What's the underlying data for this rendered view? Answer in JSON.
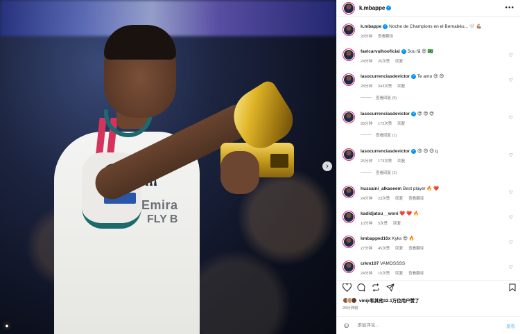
{
  "post": {
    "username": "k.mbappe",
    "more_icon": "more-horizontal-icon",
    "caption_user": "k.mbappe",
    "caption_text": "Noche de Champions en el Bernabéu... 🤍 💪🏽",
    "caption_time": "28分钟",
    "caption_translate": "查看翻译"
  },
  "photo": {
    "shirt_text_1": "Emira",
    "shirt_text_2": "FLY B",
    "carousel_next_icon": "chevron-right-icon",
    "tag_icon": "person-tag-icon"
  },
  "comments": [
    {
      "user": "faelcarvalhooficial",
      "verified": true,
      "text": "Sou fã 😍 🇧🇷",
      "time": "24分钟",
      "likes": "26次赞",
      "reply": "回复",
      "translate": "",
      "replies": ""
    },
    {
      "user": "lasocurrenciasdevictor",
      "verified": true,
      "text": "Te amo 😍 😍",
      "time": "28分钟",
      "likes": "343次赞",
      "reply": "回复",
      "translate": "",
      "replies": "查看回复 (5)"
    },
    {
      "user": "lasocurrenciasdevictor",
      "verified": true,
      "text": "😍 😍 😍",
      "time": "28分钟",
      "likes": "172次赞",
      "reply": "回复",
      "translate": "",
      "replies": "查看回复 (1)"
    },
    {
      "user": "lasocurrenciasdevictor",
      "verified": true,
      "text": "😍 😍 😍 q",
      "time": "26分钟",
      "likes": "173次赞",
      "reply": "回复",
      "translate": "",
      "replies": "查看回复 (1)"
    },
    {
      "user": "hussaini_alkaseem",
      "verified": false,
      "text": "Best player 🔥 ❤️",
      "time": "24分钟",
      "likes": "23次赞",
      "reply": "回复",
      "translate": "查看翻译",
      "replies": ""
    },
    {
      "user": "kadidjatou__woni",
      "verified": false,
      "text": "❤️ ❤️ 🔥",
      "time": "10分钟",
      "likes": "5次赞",
      "reply": "回复",
      "translate": "",
      "replies": ""
    },
    {
      "user": "kmbapped10x",
      "verified": false,
      "text": "Kyks 😍 🔥",
      "time": "27分钟",
      "likes": "45次赞",
      "reply": "回复",
      "translate": "查看翻译",
      "replies": ""
    },
    {
      "user": "crkm107",
      "verified": false,
      "text": "VAMOSSSS",
      "time": "24分钟",
      "likes": "15次赞",
      "reply": "回复",
      "translate": "查看翻译",
      "replies": ""
    }
  ],
  "actions": {
    "like_icon": "heart-icon",
    "comment_icon": "comment-icon",
    "repost_icon": "repost-icon",
    "share_icon": "send-icon",
    "save_icon": "bookmark-icon"
  },
  "likes_summary": "vinijr和其他32.1万位用户赞了",
  "post_time": "28分钟前",
  "composer": {
    "emoji_icon": "emoji-icon",
    "placeholder": "添加评论...",
    "post_label": "发布"
  },
  "colors": {
    "verified_blue": "#0095f6",
    "post_button_blue": "#8ccbfb",
    "story_ring": "#d62976"
  }
}
